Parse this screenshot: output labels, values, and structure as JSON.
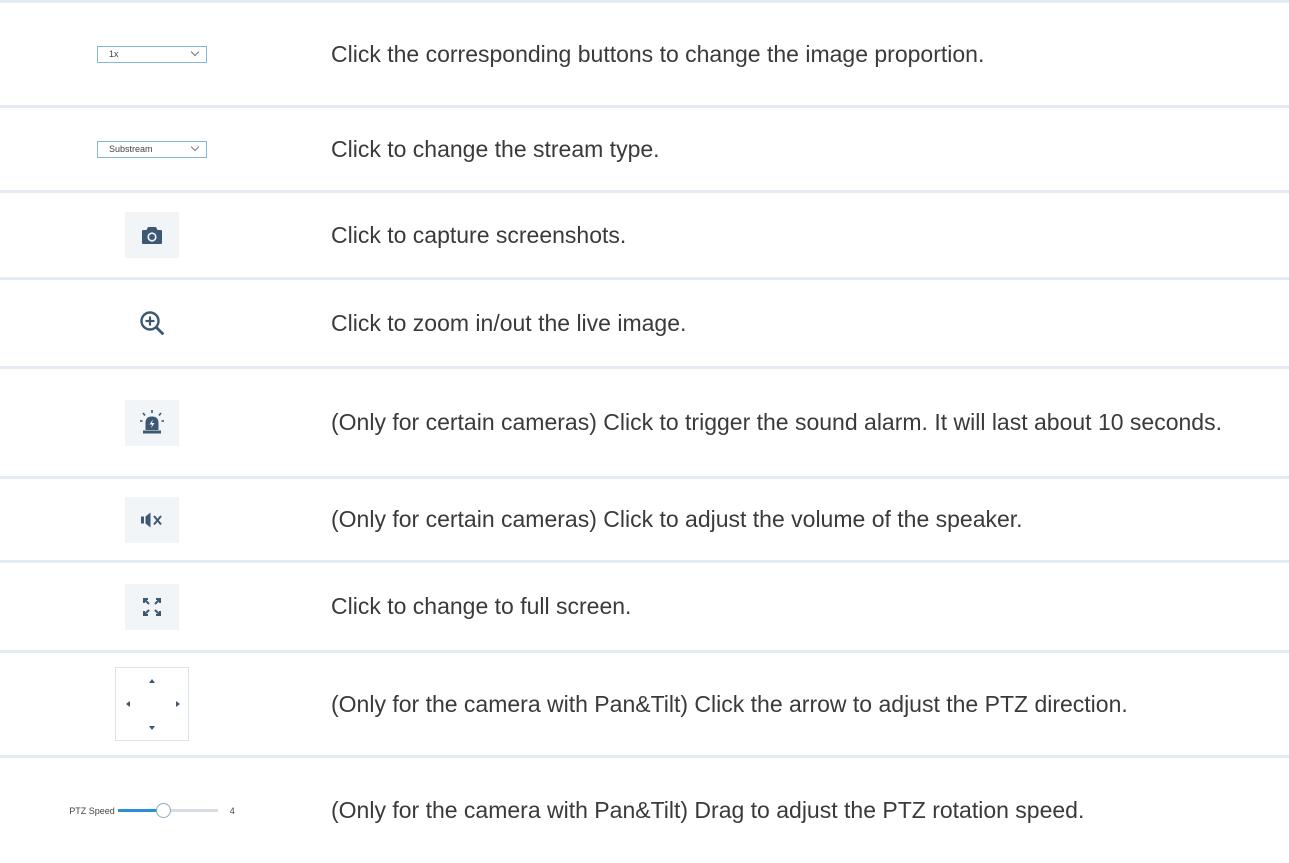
{
  "rows": [
    {
      "control": {
        "type": "dropdown",
        "value": "1x"
      },
      "description": "Click the corresponding buttons to change the image proportion."
    },
    {
      "control": {
        "type": "dropdown",
        "value": "Substream"
      },
      "description": "Click to change the stream type."
    },
    {
      "control": {
        "type": "icon",
        "icon": "camera-icon"
      },
      "description": "Click to capture screenshots."
    },
    {
      "control": {
        "type": "icon",
        "icon": "zoom-in-icon"
      },
      "description": "Click to zoom in/out the live image."
    },
    {
      "control": {
        "type": "icon",
        "icon": "siren-alarm-icon"
      },
      "description": "(Only for certain cameras) Click to trigger the sound alarm. It will last about 10 seconds."
    },
    {
      "control": {
        "type": "icon",
        "icon": "speaker-muted-icon"
      },
      "description": "(Only for certain cameras) Click to adjust the volume of the speaker."
    },
    {
      "control": {
        "type": "icon",
        "icon": "fullscreen-icon"
      },
      "description": "Click to change to full screen."
    },
    {
      "control": {
        "type": "ptz-pad",
        "icons": [
          "arrow-up-icon",
          "arrow-down-icon",
          "arrow-left-icon",
          "arrow-right-icon"
        ]
      },
      "description": "(Only for the camera with Pan&Tilt) Click the arrow to adjust the PTZ direction."
    },
    {
      "control": {
        "type": "slider",
        "label": "PTZ Speed",
        "value": "4",
        "level_fraction": 0.45
      },
      "description": "(Only for the camera with Pan&Tilt)  Drag to adjust the PTZ rotation speed."
    }
  ],
  "colors": {
    "rule": "#e4ebf2",
    "icon": "#3d5873",
    "accent": "#2a8fd4",
    "tile": "#f2f5f8"
  }
}
